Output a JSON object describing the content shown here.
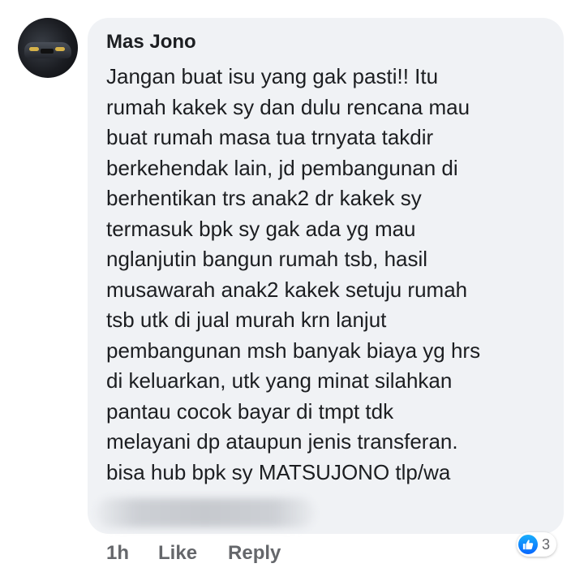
{
  "comment": {
    "author": "Mas Jono",
    "lines": [
      "Jangan buat isu yang gak pasti!! Itu",
      "rumah kakek sy dan dulu rencana mau",
      "buat rumah masa tua trnyata takdir",
      "berkehendak lain, jd pembangunan di",
      "berhentikan trs anak2 dr kakek sy",
      "termasuk bpk sy gak ada yg mau",
      "nglanjutin bangun rumah tsb, hasil",
      "musawarah anak2 kakek setuju rumah",
      "tsb utk di jual murah krn lanjut",
      "pembangunan msh banyak biaya yg hrs",
      "di keluarkan, utk yang minat silahkan",
      "pantau cocok bayar di tmpt tdk",
      "melayani dp ataupun jenis transferan.",
      "bisa hub bpk sy MATSUJONO tlp/wa"
    ]
  },
  "actions": {
    "time": "1h",
    "like_label": "Like",
    "reply_label": "Reply"
  },
  "reactions": {
    "icon": "thumbs-up-icon",
    "count": "3",
    "color": "#0866ff"
  }
}
